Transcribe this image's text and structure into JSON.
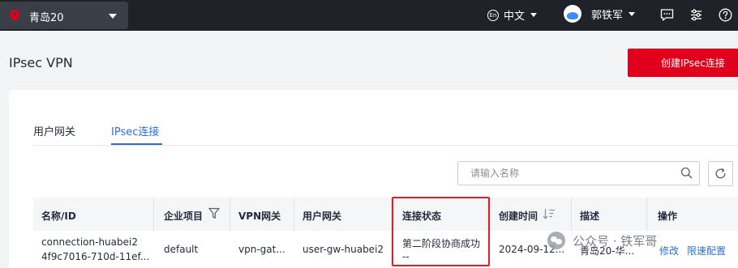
{
  "topbar": {
    "region": "青岛20",
    "language_icon_text": "En",
    "language": "中文",
    "username": "郭铁军",
    "icons": [
      "location-pin-icon",
      "globe-icon",
      "avatar",
      "message-icon",
      "settings-sliders-icon",
      "help-icon"
    ]
  },
  "header": {
    "title": "IPsec VPN",
    "create_button": "创建IPsec连接"
  },
  "tabs": [
    {
      "label": "用户网关",
      "active": false
    },
    {
      "label": "IPsec连接",
      "active": true
    }
  ],
  "search": {
    "placeholder": "请输入名称"
  },
  "table": {
    "columns": [
      "名称/ID",
      "企业项目",
      "VPN网关",
      "用户网关",
      "连接状态",
      "创建时间",
      "描述",
      "操作"
    ],
    "rows": [
      {
        "name": "connection-huabei2",
        "id": "4f9c7016-710d-11ef...",
        "enterprise_project": "default",
        "vpn_gateway": "vpn-gat...",
        "user_gateway": "user-gw-huabei2",
        "status_line1": "第二阶段协商成功",
        "status_line2": "--",
        "created": "2024-09-12...",
        "description": "青岛20-华...",
        "actions": [
          "修改",
          "限速配置"
        ]
      }
    ]
  },
  "watermark": "公众号 · 铁军哥",
  "colors": {
    "topbar_bg": "#1f2329",
    "primary_red": "#e0001b",
    "link_blue": "#2c6fd6",
    "highlight_red": "#e51c23"
  }
}
